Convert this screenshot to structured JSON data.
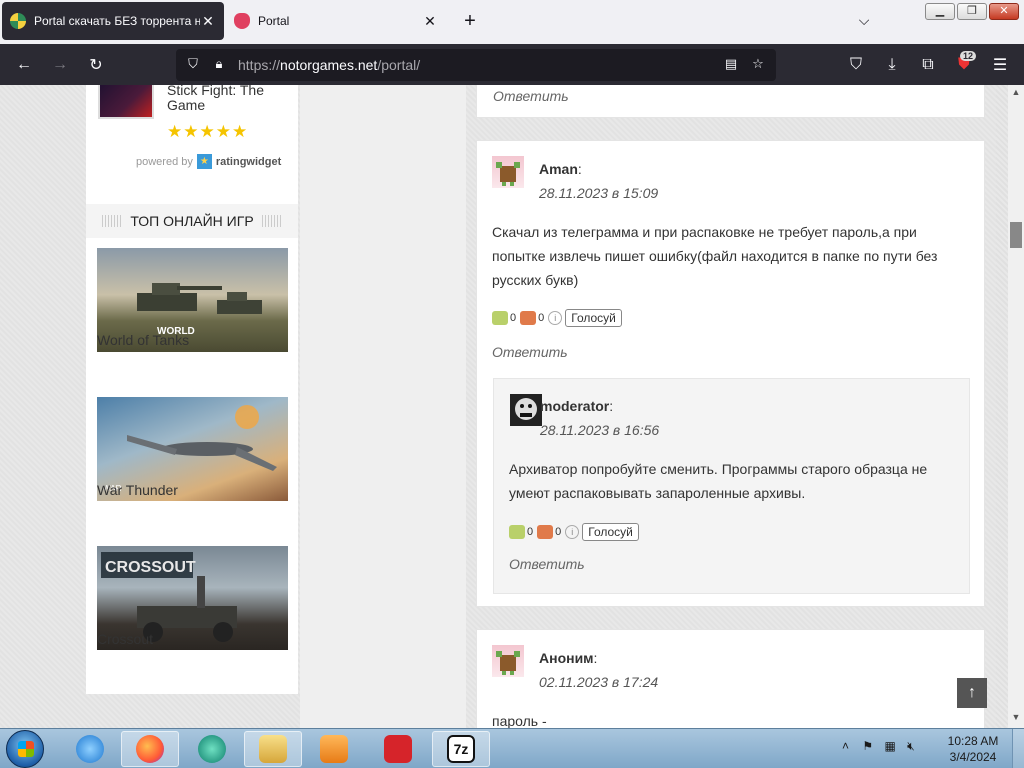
{
  "browser": {
    "tabs": [
      {
        "title": "Portal скачать БЕЗ торрента на ПК",
        "active": true
      },
      {
        "title": "Portal",
        "active": false
      }
    ],
    "url_prefix": "https://",
    "url_host": "notorgames.net",
    "url_path": "/portal/",
    "extension_badge": "12"
  },
  "sidebar": {
    "rating_widget": {
      "game_title": "Stick Fight: The Game",
      "stars": "★★★★★",
      "powered_by": "powered by",
      "brand": "ratingwidget"
    },
    "top_online": {
      "heading": "ТОП ОНЛАЙН ИГР",
      "games": [
        {
          "label": "World of Tanks"
        },
        {
          "label": "War Thunder"
        },
        {
          "label": "Crossout"
        }
      ]
    }
  },
  "comments": {
    "reply_label": "Ответить",
    "vote_label": "Голосуй",
    "items": [
      {
        "author": "Aman",
        "date": "28.11.2023 в 15:09",
        "text_lines": [
          "Скачал из телеграмма и при распаковке не требует пароль,а при",
          "попытке извлечь пишет ошибку(файл находится в папке по пути без",
          "русских букв)"
        ],
        "up": "0",
        "down": "0"
      },
      {
        "author": "moderator",
        "date": "28.11.2023 в 16:56",
        "text_lines": [
          "Архиватор попробуйте сменить. Программы старого образца не",
          "умеют распаковывать запароленные архивы."
        ],
        "up": "0",
        "down": "0"
      },
      {
        "author": "Аноним",
        "date": "02.11.2023 в 17:24",
        "text_lines": [
          "пароль -"
        ]
      }
    ]
  },
  "taskbar": {
    "time": "10:28 AM",
    "date": "3/4/2024",
    "apps": [
      "internet-explorer",
      "firefox",
      "spotify-like",
      "file-explorer",
      "media-player",
      "game-launcher",
      "7zip"
    ]
  },
  "colors": {
    "browser_dark": "#2b2a33",
    "accent_red": "#d6242a"
  }
}
